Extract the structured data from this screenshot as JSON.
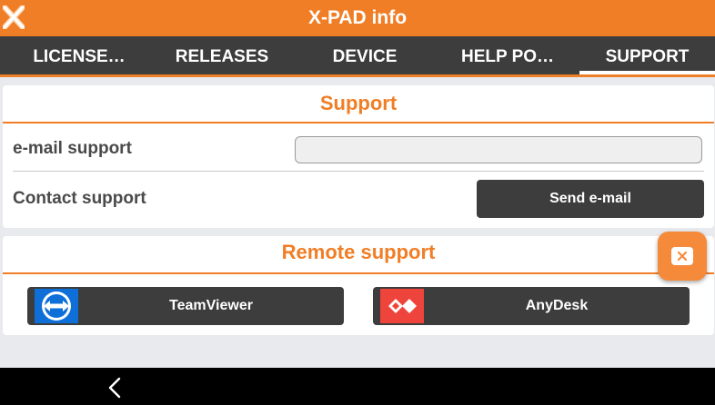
{
  "app": {
    "title": "X-PAD info",
    "accent_color": "#f07e26",
    "logo_icon": "x-pad-logo-icon"
  },
  "tabs": [
    {
      "label": "LICENSE…",
      "active": false
    },
    {
      "label": "RELEASES",
      "active": false
    },
    {
      "label": "DEVICE",
      "active": false
    },
    {
      "label": "HELP PO…",
      "active": false
    },
    {
      "label": "SUPPORT",
      "active": true
    }
  ],
  "support": {
    "title": "Support",
    "email_label": "e-mail support",
    "email_value": "",
    "contact_label": "Contact support",
    "send_button": "Send e-mail"
  },
  "remote": {
    "title": "Remote support",
    "teamviewer": {
      "label": "TeamViewer",
      "icon": "teamviewer-icon",
      "icon_color": "#0e6fd9"
    },
    "anydesk": {
      "label": "AnyDesk",
      "icon": "anydesk-icon",
      "icon_color": "#ef443b"
    }
  },
  "floating": {
    "icon": "close-icon"
  },
  "system_nav": {
    "icon": "back-icon"
  }
}
